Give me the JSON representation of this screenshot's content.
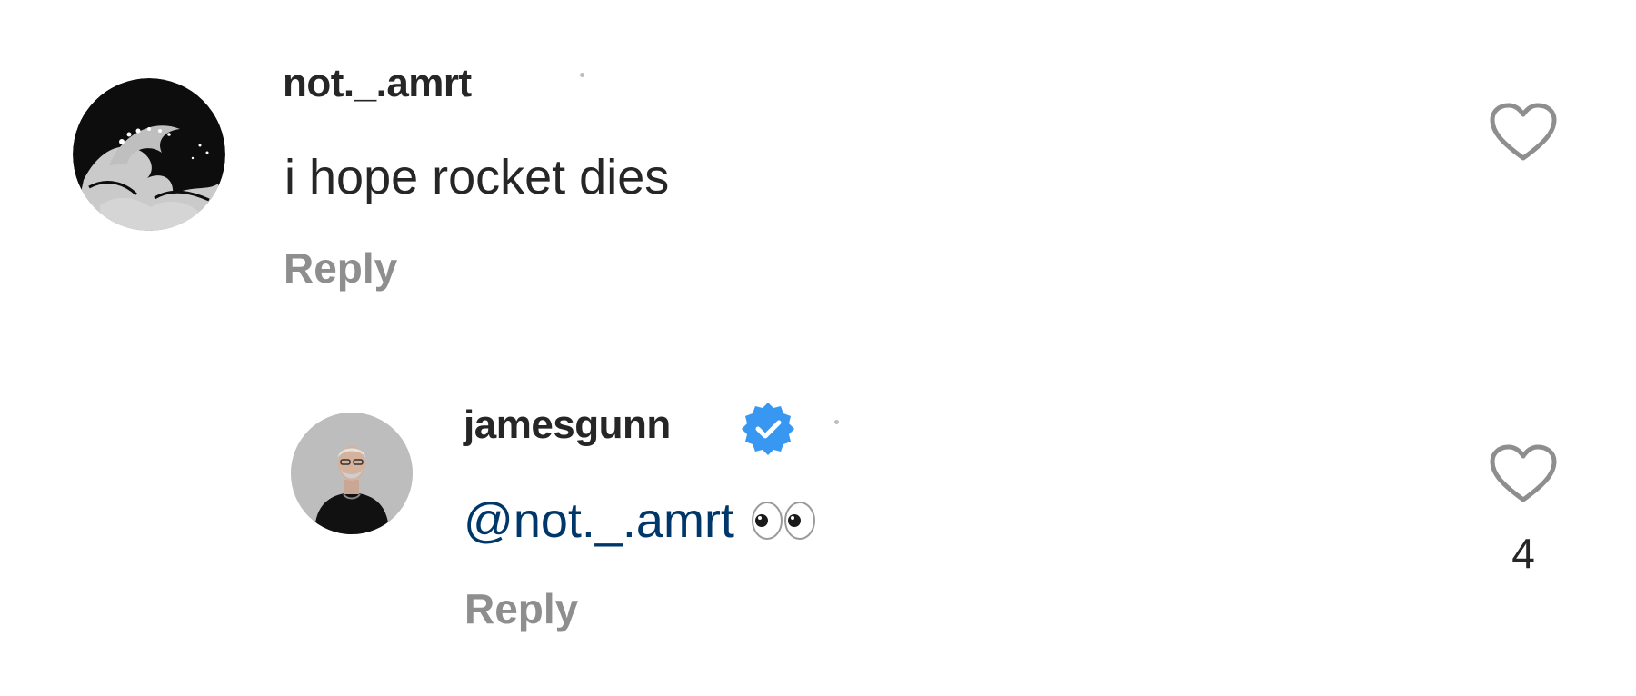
{
  "comments": [
    {
      "username": "not._.amrt",
      "text": "i hope rocket dies",
      "reply_label": "Reply",
      "avatar_icon": "great-wave-avatar",
      "like_icon": "heart-outline-icon"
    }
  ],
  "replies": [
    {
      "username": "jamesgunn",
      "verified": true,
      "verified_icon": "verified-badge-icon",
      "mention": "@not._.amrt",
      "emoji": "eyes-emoji",
      "reply_label": "Reply",
      "avatar_icon": "person-avatar",
      "like_icon": "heart-outline-icon",
      "like_count": "4"
    }
  ],
  "colors": {
    "text": "#262626",
    "muted": "#8e8e8e",
    "mention": "#00376b",
    "verified": "#3897f0"
  }
}
